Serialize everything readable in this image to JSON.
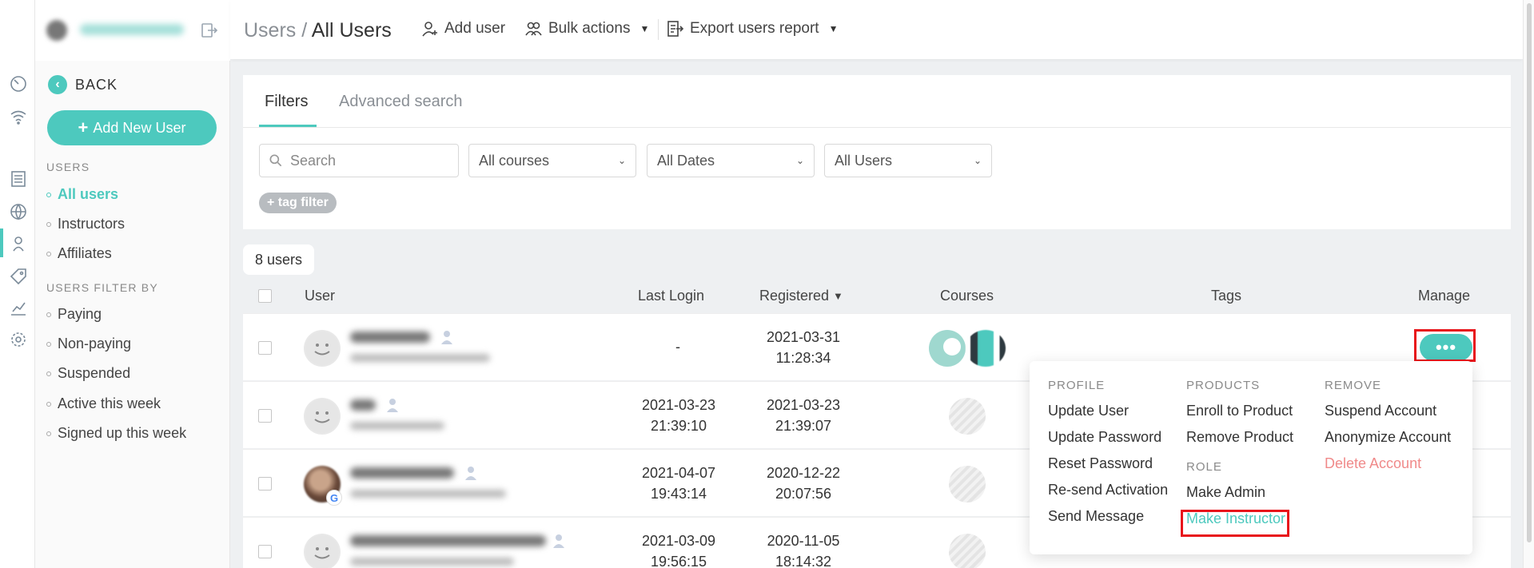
{
  "header": {
    "breadcrumb_root": "Users /",
    "breadcrumb_current": "All Users",
    "add_user": "Add user",
    "bulk_actions": "Bulk actions",
    "export_report": "Export users report"
  },
  "sidebar": {
    "back_label": "BACK",
    "add_new_user": "Add New User",
    "users_section": "USERS",
    "users_items": [
      "All users",
      "Instructors",
      "Affiliates"
    ],
    "filter_section": "USERS FILTER BY",
    "filter_items": [
      "Paying",
      "Non-paying",
      "Suspended",
      "Active this week",
      "Signed up this week"
    ]
  },
  "filters": {
    "tabs": [
      "Filters",
      "Advanced search"
    ],
    "search_placeholder": "Search",
    "courses_select": "All courses",
    "dates_select": "All Dates",
    "users_select": "All Users",
    "tag_filter": "+ tag filter"
  },
  "table": {
    "count": "8 users",
    "columns": {
      "user": "User",
      "last_login": "Last Login",
      "registered": "Registered",
      "courses": "Courses",
      "tags": "Tags",
      "manage": "Manage"
    },
    "sort_indicator": "▼",
    "rows": [
      {
        "last_login": "-",
        "registered_date": "2021-03-31",
        "registered_time": "11:28:34"
      },
      {
        "last_login_date": "2021-03-23",
        "last_login_time": "21:39:10",
        "registered_date": "2021-03-23",
        "registered_time": "21:39:07"
      },
      {
        "last_login_date": "2021-04-07",
        "last_login_time": "19:43:14",
        "registered_date": "2020-12-22",
        "registered_time": "20:07:56"
      },
      {
        "last_login_date": "2021-03-09",
        "last_login_time": "19:56:15",
        "registered_date": "2020-11-05",
        "registered_time": "18:14:32"
      }
    ],
    "manage_button": "•••"
  },
  "menu": {
    "profile_title": "PROFILE",
    "profile_items": [
      "Update User",
      "Update Password",
      "Reset Password",
      "Re-send Activation",
      "Send Message"
    ],
    "products_title": "PRODUCTS",
    "products_items": [
      "Enroll to Product",
      "Remove Product"
    ],
    "role_title": "ROLE",
    "role_items": [
      "Make Admin",
      "Make Instructor"
    ],
    "remove_title": "REMOVE",
    "remove_items": [
      "Suspend Account",
      "Anonymize Account",
      "Delete Account"
    ]
  },
  "colors": {
    "accent": "#4dc9be",
    "danger": "#f08a8a",
    "highlight": "#e8151b"
  }
}
